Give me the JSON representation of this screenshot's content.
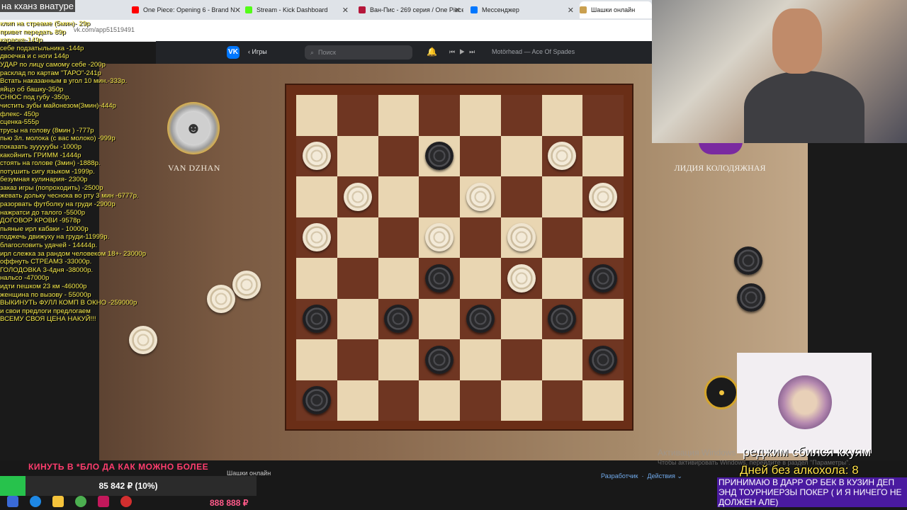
{
  "browser": {
    "tabs": [
      {
        "title": "One Piece: Opening 6 - Brand N",
        "color": "#ff0000"
      },
      {
        "title": "Stream - Kick Dashboard",
        "color": "#53fc18"
      },
      {
        "title": "Ван-Пис - 269 серия / One Piece",
        "color": "#b5163a"
      },
      {
        "title": "Мессенджер",
        "color": "#0077ff"
      },
      {
        "title": "Шашки онлайн",
        "color": "#caa050"
      }
    ],
    "url": "vk.com/app51519491"
  },
  "vk": {
    "logo": "VK",
    "back_label": "Игры",
    "search_placeholder": "Поиск",
    "track": "Motörhead — Ace Of Spades",
    "bottom_label": "Шашки онлайн",
    "developer_link": "Разработчик",
    "actions_link": "Действия ⌄"
  },
  "game": {
    "player1_name": "VAN DZHAN",
    "player2_name": "ЛИДИЯ КОЛОДЯЖНАЯ",
    "board": [
      "........",
      "w..b..w.",
      ".w..w..w",
      "w..w.w..",
      "...b.w.b",
      "b.b.b.b.",
      "...b...b",
      "b......."
    ]
  },
  "overlay": {
    "title_overlay": "на кханз внатуре",
    "donations": [
      "клип на стреаме (5мин)- 29р",
      "привет передать 89р",
      "караоке-149р",
      "себе подзатыльника -144р",
      "двоечка и с ноги 144р",
      "УДАР по лицу самому себе -200р",
      "расклад по картам \"ТАРО\"-241р",
      "Встать наказанным в угол 10 мин.-333р.",
      "яйцо об башку-350р",
      "СНЮС под губу -350р.",
      "чистить зубы майонезом(3мин)-444р",
      "флекс- 450р",
      "сценка-555р",
      "трусы на голову (8мин ) -777р",
      "пью 3л. молока (с вас молоко) -999р",
      "показать зууууубы -1000р",
      "какойнить ГРИММ -1444р",
      "стоять на голове (3мин) -1888р.",
      "потушить сигу языком -1999р.",
      "безумная кулинария- 2300р",
      "заказ игры (попроходить) -2500р",
      "жевать дольку чеснока во рту 3 мин -6777р.",
      "разорвать футболку на груди -2900р",
      "нажратси до талого -5500р",
      "ДОГОВОР КРОВИ -9578р",
      "пьяные ирл кабаки - 10000р",
      "поджечь движуху на груди-11999р.",
      "благословить удачей - 14444р.",
      "ирл слежка за рандом человеком 18+- 23000р",
      "оффнуть СТРЕАМЗ -33000р.",
      "ГОЛОДОВКА 3-4дня -38000р.",
      "нальсо -47000р",
      "идти пешком 23 км -46000р",
      "женщина по вызову - 55000р",
      "ВЫКИНУТЬ ФУЛЛ КОМП В ОКНО -259000р",
      "и свои предлоги предлогаем",
      "ВСЕМУ СВОЯ ЦЕНА НАКУЙ!!!"
    ],
    "scroll_message": "КИНУТЬ В *БЛО ДА КАК МОЖНО БОЛЕЕ",
    "goal_text": "85 842 ₽ (10%)",
    "goal_fraction": 0.1,
    "goal_sum": "888 888 ₽",
    "activation_title": "Активация Windows",
    "activation_sub": "Чтобы активировать Windows, перейдите в раздел \"Параметры\".",
    "right_text1": "реджим сбился кхуям",
    "right_text2": "Дней без алкохола: 8",
    "right_text3": "ПРИНИМАЮ В ДАРР ОР БЕК В КУЗИН ДЕП ЭНД ТОУРНИЕРЗЫ ПОКЕР ( И Я НИЧЕГО НЕ ДОЛЖЕН АЛЕ)"
  }
}
